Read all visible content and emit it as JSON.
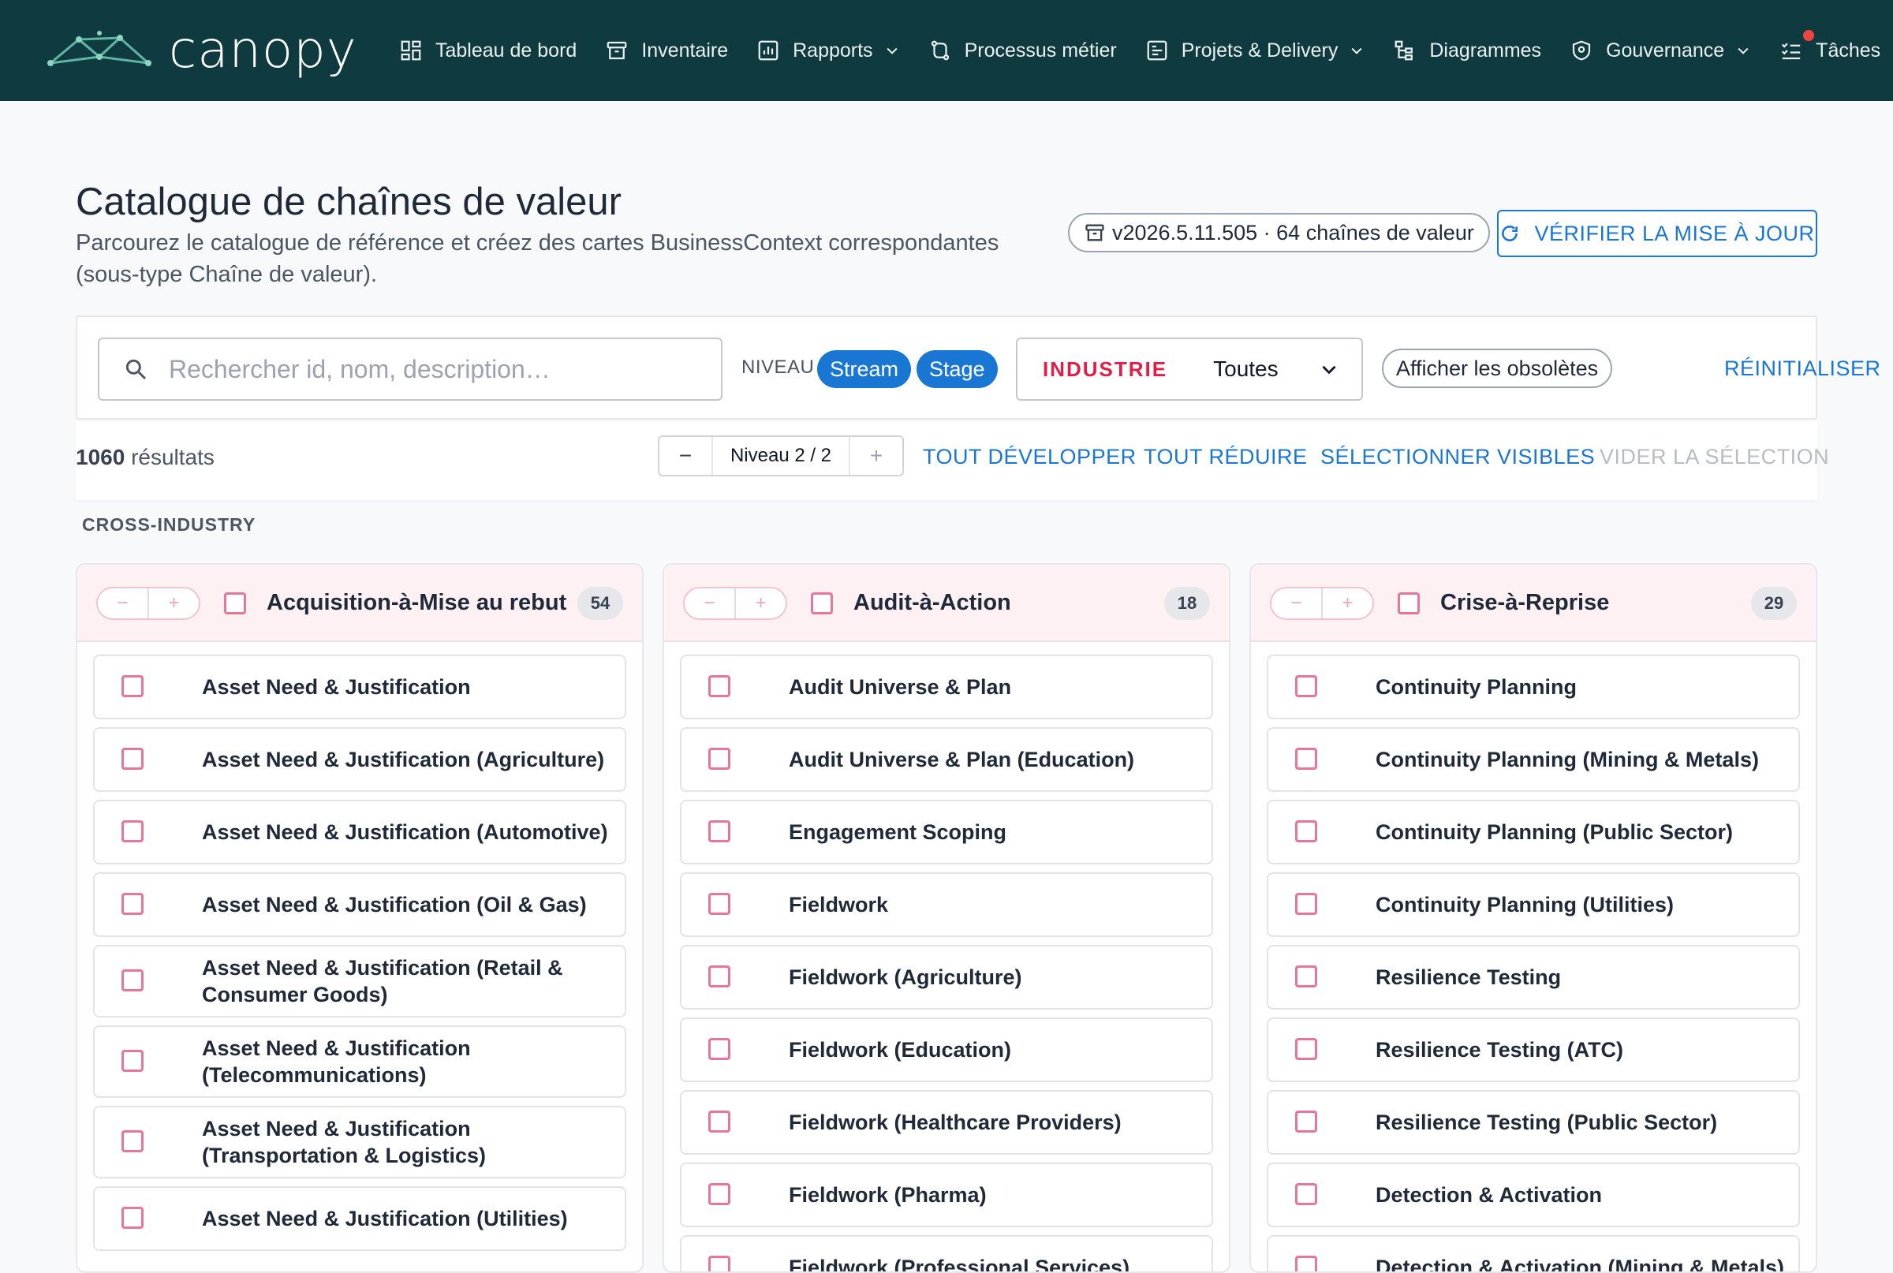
{
  "nav": {
    "brand": "canopy",
    "items": [
      {
        "label": "Tableau de bord",
        "icon": "dashboard-icon",
        "caret": false
      },
      {
        "label": "Inventaire",
        "icon": "archive-icon",
        "caret": false
      },
      {
        "label": "Rapports",
        "icon": "report-icon",
        "caret": true
      },
      {
        "label": "Processus métier",
        "icon": "process-icon",
        "caret": false
      },
      {
        "label": "Projets & Delivery",
        "icon": "project-icon",
        "caret": true
      },
      {
        "label": "Diagrammes",
        "icon": "diagram-icon",
        "caret": false
      },
      {
        "label": "Gouvernance",
        "icon": "shield-icon",
        "caret": true
      },
      {
        "label": "Tâches",
        "icon": "tasks-icon",
        "caret": false,
        "dot": true
      }
    ]
  },
  "header": {
    "title": "Catalogue de chaînes de valeur",
    "subtitle": "Parcourez le catalogue de référence et créez des cartes BusinessContext correspondantes (sous-type Chaîne de valeur).",
    "version": "v2026.5.11.505 · 64 chaînes de valeur",
    "update_button": "VÉRIFIER LA MISE À JOUR"
  },
  "filters": {
    "search_placeholder": "Rechercher id, nom, description…",
    "level_label": "NIVEAU",
    "level_chips": [
      "Stream",
      "Stage"
    ],
    "industry_label": "INDUSTRIE",
    "industry_value": "Toutes",
    "obsolete_toggle": "Afficher les obsolètes",
    "reset": "RÉINITIALISER"
  },
  "results": {
    "count": "1060",
    "count_suffix": "résultats",
    "level_stepper": "Niveau 2 / 2",
    "expand_all": "TOUT DÉVELOPPER",
    "collapse_all": "TOUT RÉDUIRE",
    "select_visible": "SÉLECTIONNER VISIBLES",
    "clear_selection": "VIDER LA SÉLECTION"
  },
  "section": "CROSS-INDUSTRY",
  "colors": {
    "nav_bg": "#0f3a3f",
    "accent": "#1976d2",
    "checkbox": "#e8769a",
    "column_header": "#fdf1f4"
  },
  "columns": [
    {
      "title": "Acquisition-à-Mise au rebut",
      "count": "54",
      "items": [
        "Asset Need & Justification",
        "Asset Need & Justification (Agriculture)",
        "Asset Need & Justification (Automotive)",
        "Asset Need & Justification (Oil & Gas)",
        "Asset Need & Justification (Retail & Consumer Goods)",
        "Asset Need & Justification (Telecommunications)",
        "Asset Need & Justification (Transportation & Logistics)",
        "Asset Need & Justification (Utilities)"
      ]
    },
    {
      "title": "Audit-à-Action",
      "count": "18",
      "items": [
        "Audit Universe & Plan",
        "Audit Universe & Plan (Education)",
        "Engagement Scoping",
        "Fieldwork",
        "Fieldwork (Agriculture)",
        "Fieldwork (Education)",
        "Fieldwork (Healthcare Providers)",
        "Fieldwork (Pharma)",
        "Fieldwork (Professional Services)"
      ]
    },
    {
      "title": "Crise-à-Reprise",
      "count": "29",
      "items": [
        "Continuity Planning",
        "Continuity Planning (Mining & Metals)",
        "Continuity Planning (Public Sector)",
        "Continuity Planning (Utilities)",
        "Resilience Testing",
        "Resilience Testing (ATC)",
        "Resilience Testing (Public Sector)",
        "Detection & Activation",
        "Detection & Activation (Mining & Metals)"
      ]
    }
  ]
}
